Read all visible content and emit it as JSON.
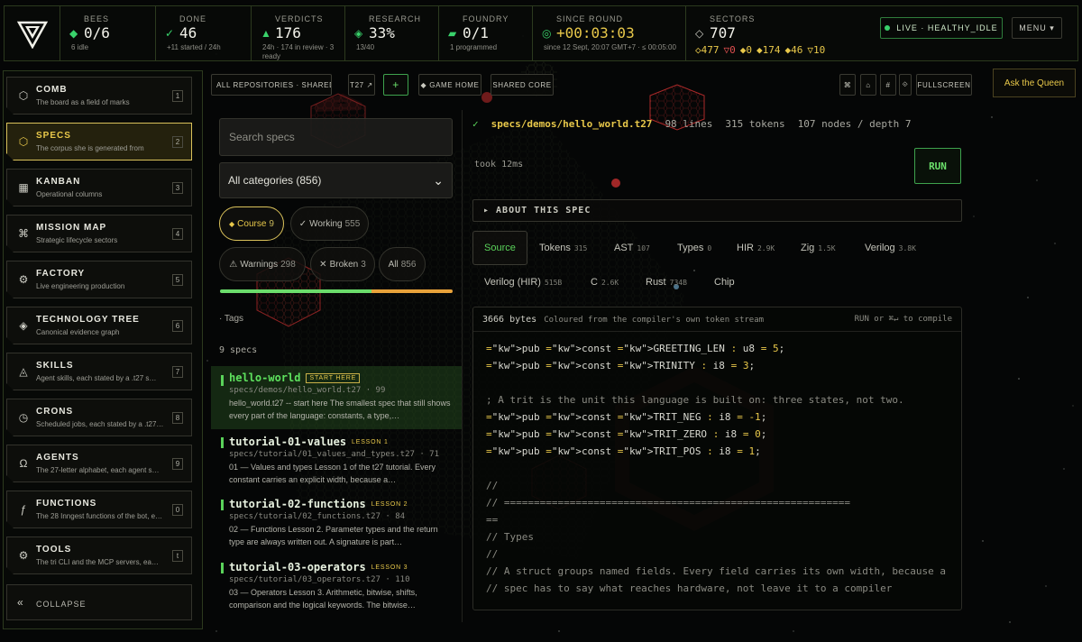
{
  "topbar": {
    "bees": {
      "label": "BEES",
      "value": "0/6",
      "sub": "6 idle"
    },
    "done": {
      "label": "DONE",
      "value": "46",
      "sub": "+11 started / 24h"
    },
    "verdicts": {
      "label": "VERDICTS",
      "value": "176",
      "sub": "24h · 174 in review · 3 ready"
    },
    "research": {
      "label": "RESEARCH",
      "value": "33%",
      "sub": "13/40"
    },
    "foundry": {
      "label": "FOUNDRY",
      "value": "0/1",
      "sub": "1 programmed"
    },
    "since_round": {
      "label": "SINCE ROUND",
      "value": "+00:03:03",
      "sub": "since 12 Sept, 20:07 GMT+7 · ≤ 00:05:00"
    },
    "sectors": {
      "label": "SECTORS",
      "value": "707",
      "counts": [
        {
          "icon": "diamond-hollow-icon",
          "value": "477",
          "color": "#e8c84a"
        },
        {
          "icon": "triangle-down-icon",
          "value": "0",
          "color": "#e05050"
        },
        {
          "icon": "diamond-icon",
          "value": "0",
          "color": "#e8c84a"
        },
        {
          "icon": "diamond-icon",
          "value": "174",
          "color": "#e8c84a"
        },
        {
          "icon": "diamond-icon",
          "value": "46",
          "color": "#e8c84a"
        },
        {
          "icon": "triangle-down-icon",
          "value": "10",
          "color": "#e8c84a"
        }
      ]
    },
    "live": "LIVE · HEALTHY_IDLE",
    "menu": "MENU ▾"
  },
  "sidebar": {
    "items": [
      {
        "title": "COMB",
        "sub": "The board as a field of marks",
        "key": "1",
        "icon": "⬡"
      },
      {
        "title": "SPECS",
        "sub": "The corpus she is generated from",
        "key": "2",
        "icon": "⬡"
      },
      {
        "title": "KANBAN",
        "sub": "Operational columns",
        "key": "3",
        "icon": "▦"
      },
      {
        "title": "MISSION MAP",
        "sub": "Strategic lifecycle sectors",
        "key": "4",
        "icon": "⌘"
      },
      {
        "title": "FACTORY",
        "sub": "Live engineering production",
        "key": "5",
        "icon": "⚙"
      },
      {
        "title": "TECHNOLOGY TREE",
        "sub": "Canonical evidence graph",
        "key": "6",
        "icon": "◈"
      },
      {
        "title": "SKILLS",
        "sub": "Agent skills, each stated by a .t27 s…",
        "key": "7",
        "icon": "◬"
      },
      {
        "title": "CRONS",
        "sub": "Scheduled jobs, each stated by a .t27…",
        "key": "8",
        "icon": "◷"
      },
      {
        "title": "AGENTS",
        "sub": "The 27-letter alphabet, each agent s…",
        "key": "9",
        "icon": "Ω"
      },
      {
        "title": "FUNCTIONS",
        "sub": "The 28 Inngest functions of the bot, e…",
        "key": "0",
        "icon": "ƒ"
      },
      {
        "title": "TOOLS",
        "sub": "The tri CLI and the MCP servers, ea…",
        "key": "t",
        "icon": "⚙"
      }
    ],
    "collapse": "COLLAPSE"
  },
  "toolbar": {
    "repos": "ALL REPOSITORIES · SHARED M…",
    "t27": "T27 ↗",
    "plus": "+",
    "game_home": "GAME HOME",
    "shared_core": "SHARED CORE",
    "icons": [
      "⌘",
      "⌂",
      "#",
      "⟐"
    ],
    "fullscreen": "FULLSCREEN",
    "ask": "Ask the Queen"
  },
  "list": {
    "search_placeholder": "Search specs",
    "category": "All categories (856)",
    "chips": [
      {
        "label": "Course",
        "count": "9",
        "icon": "◆"
      },
      {
        "label": "Working",
        "count": "555",
        "icon": "✓"
      },
      {
        "label": "Warnings",
        "count": "298",
        "icon": "⚠"
      },
      {
        "label": "Broken",
        "count": "3",
        "icon": "✕"
      },
      {
        "label": "All",
        "count": "856",
        "icon": ""
      }
    ],
    "progress": {
      "working": 0.65,
      "warnings": 0.35
    },
    "tags": "· Tags",
    "count": "9 specs",
    "specs": [
      {
        "name": "hello-world",
        "badge": "START HERE",
        "path": "specs/demos/hello_world.t27 · 99",
        "desc": "hello_world.t27 -- start here The smallest spec that still shows every part of the language: constants, a type,…"
      },
      {
        "name": "tutorial-01-values",
        "badge": "LESSON 1",
        "path": "specs/tutorial/01_values_and_types.t27 · 71",
        "desc": "01 — Values and types Lesson 1 of the t27 tutorial. Every constant carries an explicit width, because a…"
      },
      {
        "name": "tutorial-02-functions",
        "badge": "LESSON 2",
        "path": "specs/tutorial/02_functions.t27 · 84",
        "desc": "02 — Functions Lesson 2. Parameter types and the return type are always written out. A signature is part…"
      },
      {
        "name": "tutorial-03-operators",
        "badge": "LESSON 3",
        "path": "specs/tutorial/03_operators.t27 · 110",
        "desc": "03 — Operators Lesson 3. Arithmetic, bitwise, shifts, comparison and the logical keywords. The bitwise…"
      }
    ]
  },
  "detail": {
    "check": "✓",
    "file": "specs/demos/hello_world.t27",
    "lines": "98 lines",
    "tokens": "315 tokens",
    "nodes": "107 nodes / depth 7",
    "took": "took 12ms",
    "run": "RUN",
    "about": "▸ ABOUT THIS SPEC",
    "tabs": [
      {
        "label": "Source",
        "n": ""
      },
      {
        "label": "Tokens",
        "n": "315"
      },
      {
        "label": "AST",
        "n": "107"
      },
      {
        "label": "Types",
        "n": "0"
      },
      {
        "label": "HIR",
        "n": "2.9K"
      },
      {
        "label": "Zig",
        "n": "1.5K"
      },
      {
        "label": "Verilog",
        "n": "3.8K"
      },
      {
        "label": "Verilog (HIR)",
        "n": "515B"
      },
      {
        "label": "C",
        "n": "2.6K"
      },
      {
        "label": "Rust",
        "n": "734B"
      },
      {
        "label": "Chip",
        "n": ""
      }
    ],
    "code_bytes": "3666 bytes",
    "code_note": "Coloured from the compiler's own token stream",
    "code_hint": "RUN or ⌘↵ to compile",
    "code_lines": [
      "pub const GREETING_LEN : u8 = 5;",
      "pub const TRINITY : i8 = 3;",
      "",
      "; A trit is the unit this language is built on: three states, not two.",
      "pub const TRIT_NEG : i8 = -1;",
      "pub const TRIT_ZERO : i8 = 0;",
      "pub const TRIT_POS : i8 = 1;",
      "",
      "//",
      "// ==========================================================",
      "==",
      "// Types",
      "//",
      "// A struct groups named fields. Every field carries its own width, because a",
      "// spec has to say what reaches hardware, not leave it to a compiler"
    ]
  }
}
